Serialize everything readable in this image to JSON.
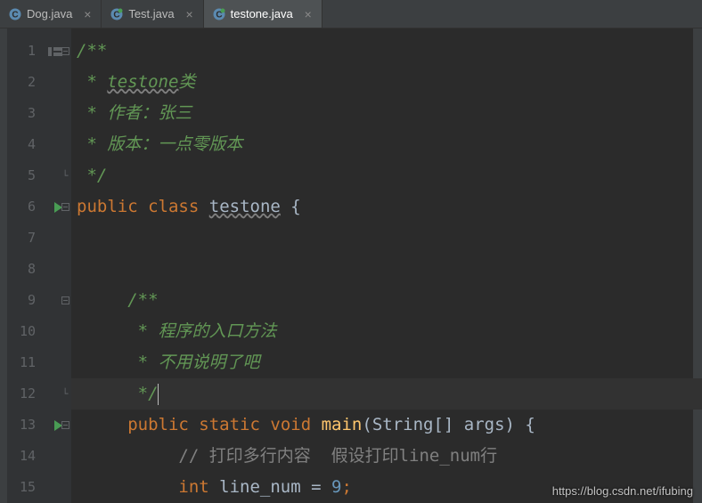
{
  "tabs": [
    {
      "label": "Dog.java",
      "active": false
    },
    {
      "label": "Test.java",
      "active": false
    },
    {
      "label": "testone.java",
      "active": true
    }
  ],
  "line_numbers": [
    "1",
    "2",
    "3",
    "4",
    "5",
    "6",
    "7",
    "8",
    "9",
    "10",
    "11",
    "12",
    "13",
    "14",
    "15"
  ],
  "code": {
    "l1": "/**",
    "l2_a": " * ",
    "l2_b": "testone",
    "l2_c": "类",
    "l3": " * 作者：张三",
    "l4": " * 版本：一点零版本",
    "l5": " */",
    "l6_kw1": "public",
    "l6_kw2": "class",
    "l6_name": "testone",
    "l6_brace": "{",
    "l9": "/**",
    "l10": " * 程序的入口方法",
    "l11": " * 不用说明了吧",
    "l12": " */",
    "l13_kw1": "public",
    "l13_kw2": "static",
    "l13_kw3": "void",
    "l13_method": "main",
    "l13_params": "(String[] args) {",
    "l14_cm": "// ",
    "l14_txt": "打印多行内容  假设打印line_num行",
    "l15_kw": "int",
    "l15_var": "line_num",
    "l15_eq": " = ",
    "l15_val": "9",
    "l15_semi": ";"
  },
  "watermark": "https://blog.csdn.net/ifubing"
}
